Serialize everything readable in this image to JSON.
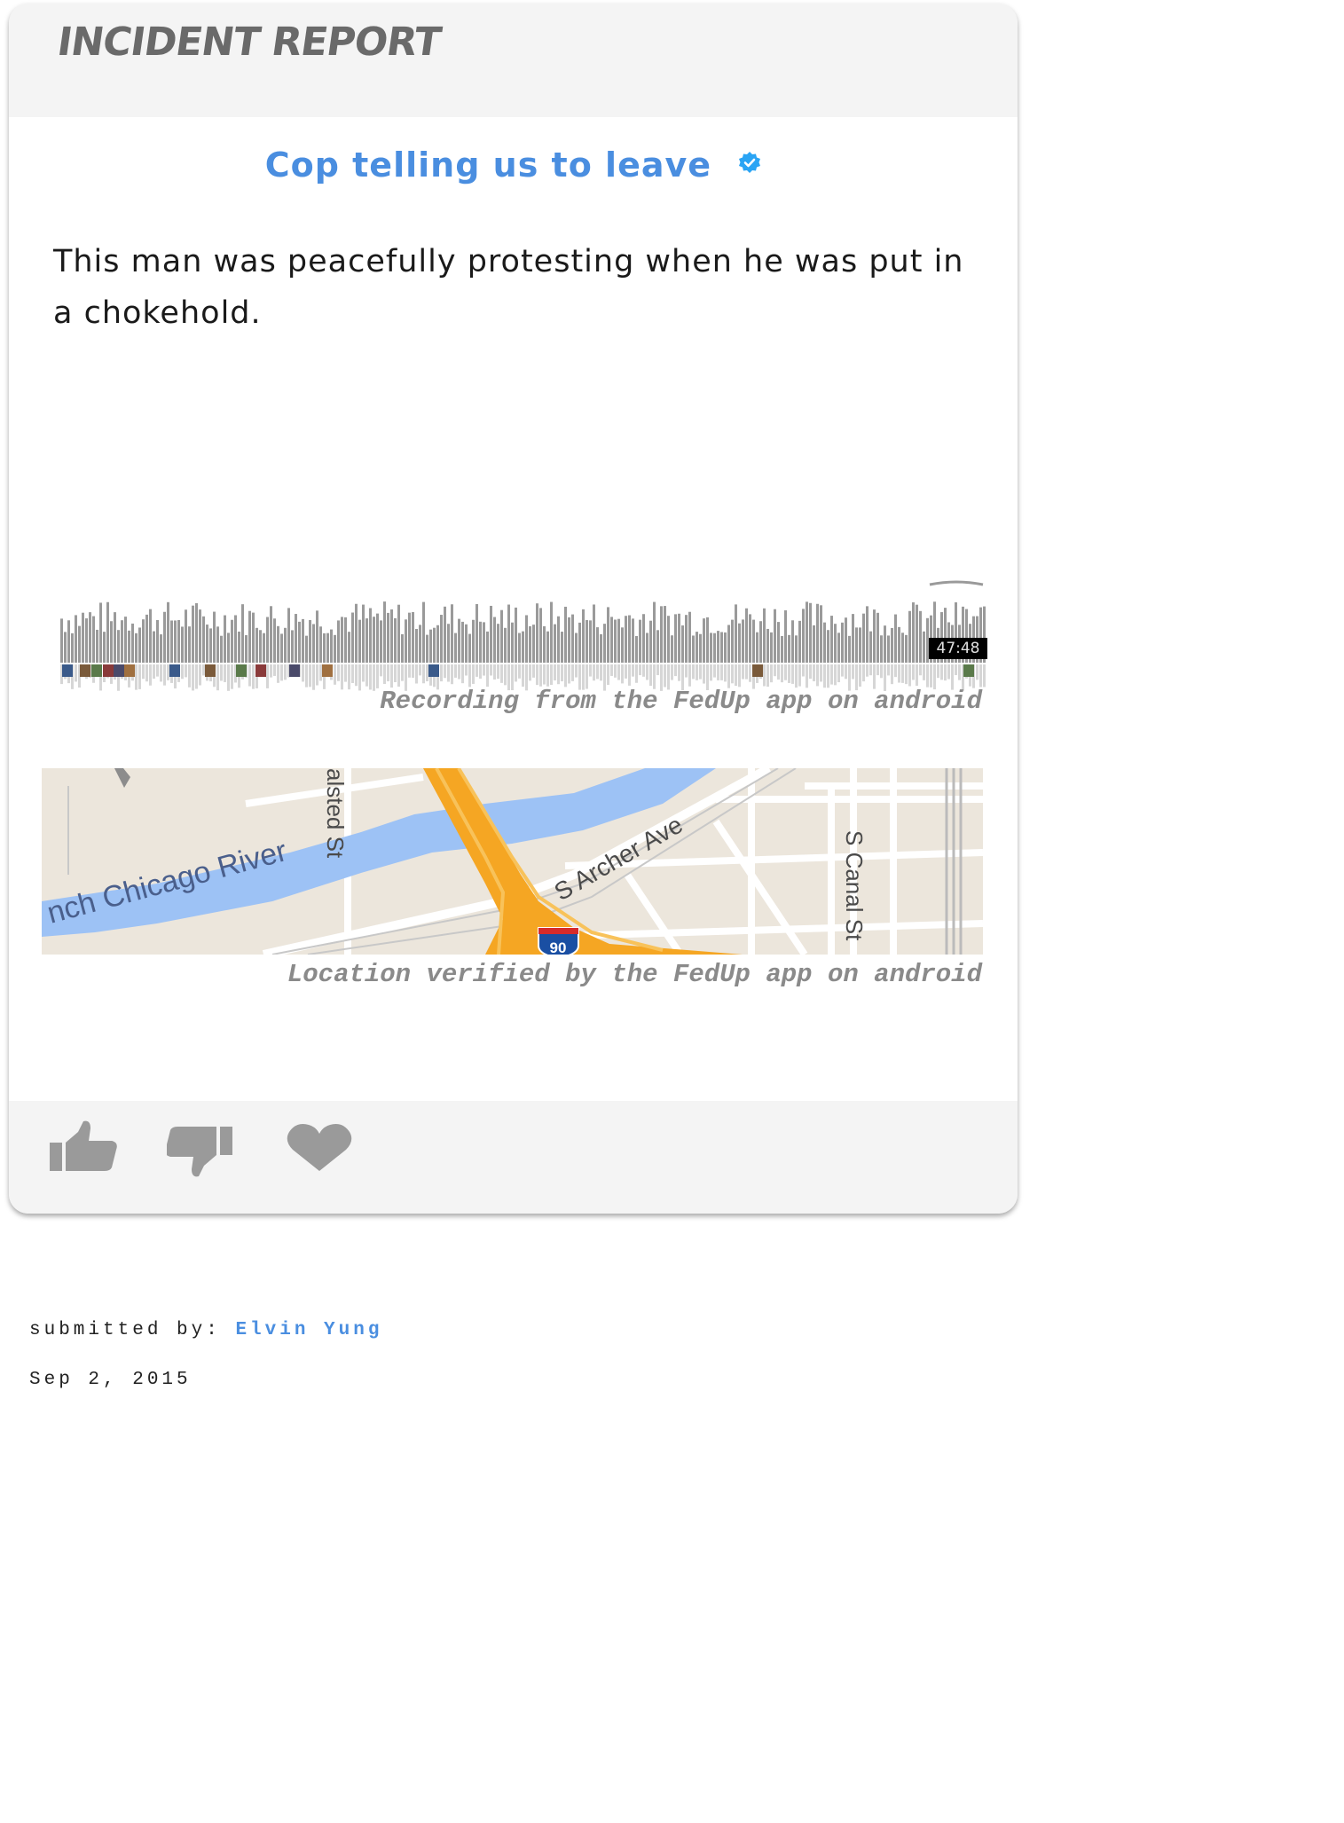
{
  "header": {
    "brand": "INCIDENT REPORT"
  },
  "report": {
    "title": "Cop telling us to leave",
    "description": "This man was peacefully protesting when he was put in a chokehold."
  },
  "recording": {
    "duration": "47:48",
    "caption": "Recording from the FedUp app on android"
  },
  "map": {
    "caption": "Location verified by the FedUp app on android",
    "labels": {
      "river": "nch Chicago River",
      "halsted": "alsted St",
      "archer": "S Archer Ave",
      "canal": "S Canal St",
      "interstate": "90"
    }
  },
  "actions": {
    "icons": [
      "thumbs-up-icon",
      "thumbs-down-icon",
      "heart-icon"
    ]
  },
  "submission": {
    "label": "submitted by:",
    "author": "Elvin Yung",
    "date": "Sep 2, 2015"
  },
  "colors": {
    "accent": "#4a8ee0",
    "verified": "#2aa4f4",
    "header_bg": "#f4f4f4",
    "icon_gray": "#9a9a9a",
    "highway": "#f5a623",
    "river": "#9dc2f5"
  }
}
